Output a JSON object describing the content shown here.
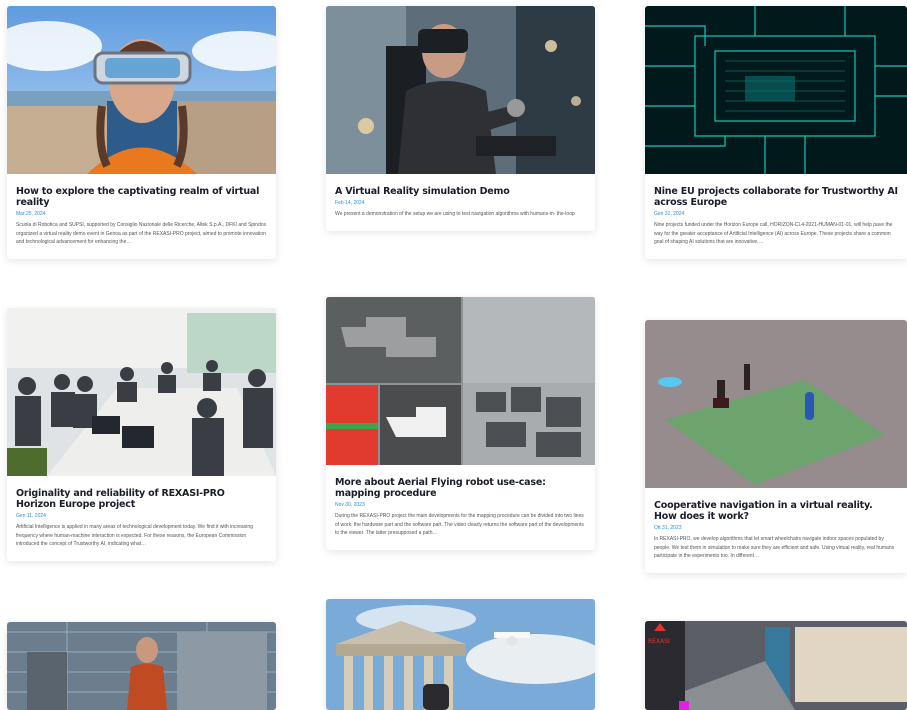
{
  "posts": [
    {
      "title": "How to explore the captivating realm of virtual reality",
      "date": "Mar 25, 2024",
      "excerpt": "Scuola di Robotica and SUPSI, supported by Consiglio Nazionale delle Ricerche, Altek S.p.A., DFKI and Spindox organized a virtual reality demo event in Genoa as part of the REXASI-PRO project, aimed to promote innovation and technological advancement for enhancing the…",
      "image": "woman-vr-headset"
    },
    {
      "title": "A Virtual Reality simulation Demo",
      "date": "Feb 14, 2024",
      "excerpt": "We present a demonstration of the setup we are using to test navigation algorithms with humans-in- the-loop",
      "image": "man-vr-wheelchair"
    },
    {
      "title": "Nine EU projects collaborate for Trustworthy AI across Europe",
      "date": "Gen 31, 2024",
      "excerpt": "Nine projects funded under the Horizon Europe call, HORIZON-CL4-2021-HUMAN-01-01, will help pave the way for the greater acceptance of Artificial Intelligence (AI) across Europe. These projects share a common goal of shaping AI solutions that are innovative,…",
      "image": "circuit-board"
    },
    {
      "title": "Originality and reliability of REXASI-PRO Horizon Europe project",
      "date": "Gen 11, 2024",
      "excerpt": "Artificial Intelligence is applied in many areas of technological development today. We find it with increasing frequency where human-machine interaction is expected. For these reasons, the European Commission introduced the concept of Trustworthy AI, indicating what…",
      "image": "meeting-room"
    },
    {
      "title": "More about Aerial Flying robot use-case: mapping procedure",
      "date": "Nov 30, 2023",
      "excerpt": "During the REXASI-PRO project the main developments for the mapping procedure can be divided into two lines of work: the hardware part and the software part. The video clearly returns the software part of the developments to the viewer. The latter presupposed a path…",
      "image": "mapping-screens"
    },
    {
      "title": "Cooperative navigation in a virtual reality. How does it work?",
      "date": "Ott 31, 2023",
      "excerpt": "In REXASI-PRO, we develop algorithms that let smart wheelchairs navigate indoor spaces populated by people. We test them in simulation to make sure they are efficient and safe. Using virtual reality, real humans participate in the experiments too. In different…",
      "image": "virtual-simulation"
    },
    {
      "title": "",
      "date": "",
      "excerpt": "",
      "image": "warehouse-woman"
    },
    {
      "title": "",
      "date": "",
      "excerpt": "",
      "image": "temple-drone"
    },
    {
      "title": "",
      "date": "",
      "excerpt": "",
      "image": "rexasi-scene"
    }
  ],
  "logo_text": "REXASI",
  "colors": {
    "date": "#2b8fd6",
    "title": "#1a1d2a",
    "text": "#555555"
  }
}
